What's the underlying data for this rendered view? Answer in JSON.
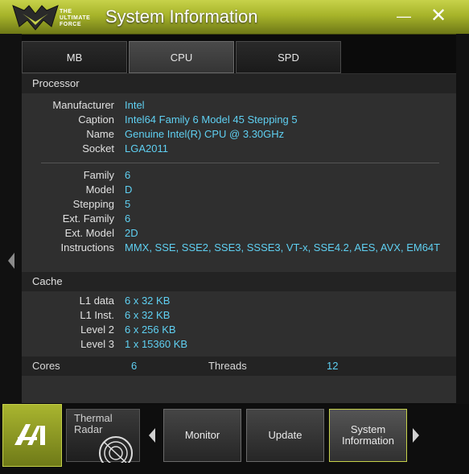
{
  "window": {
    "title": "System Information",
    "logo_text": [
      "THE",
      "ULTIMATE",
      "FORCE"
    ],
    "minimize_glyph": "—",
    "close_glyph": "✕"
  },
  "tabs": [
    {
      "label": "MB",
      "active": false
    },
    {
      "label": "CPU",
      "active": true
    },
    {
      "label": "SPD",
      "active": false
    }
  ],
  "processor": {
    "header": "Processor",
    "rows": [
      {
        "label": "Manufacturer",
        "value": "Intel"
      },
      {
        "label": "Caption",
        "value": "Intel64 Family 6 Model 45 Stepping 5"
      },
      {
        "label": "Name",
        "value": "Genuine Intel(R) CPU @ 3.30GHz"
      },
      {
        "label": "Socket",
        "value": "LGA2011"
      }
    ],
    "rows2": [
      {
        "label": "Family",
        "value": "6"
      },
      {
        "label": "Model",
        "value": "D"
      },
      {
        "label": "Stepping",
        "value": "5"
      },
      {
        "label": "Ext. Family",
        "value": "6"
      },
      {
        "label": "Ext. Model",
        "value": "2D"
      },
      {
        "label": "Instructions",
        "value": "MMX, SSE, SSE2, SSE3, SSSE3, VT-x, SSE4.2, AES, AVX, EM64T"
      }
    ]
  },
  "cache": {
    "header": "Cache",
    "rows": [
      {
        "label": "L1 data",
        "value": "6 x 32 KB"
      },
      {
        "label": "L1 Inst.",
        "value": "6 x 32 KB"
      },
      {
        "label": "Level 2",
        "value": "6 x 256 KB"
      },
      {
        "label": "Level 3",
        "value": "1 x 15360 KB"
      }
    ]
  },
  "summary": {
    "cores_label": "Cores",
    "cores_value": "6",
    "threads_label": "Threads",
    "threads_value": "12"
  },
  "bottombar": {
    "thermal_label": "Thermal Radar",
    "buttons": [
      {
        "label": "Monitor",
        "active": false
      },
      {
        "label": "Update",
        "active": false
      },
      {
        "label": "System Information",
        "active": true
      }
    ]
  },
  "colors": {
    "accent": "#a7b42a",
    "value_text": "#5fd0f2"
  }
}
